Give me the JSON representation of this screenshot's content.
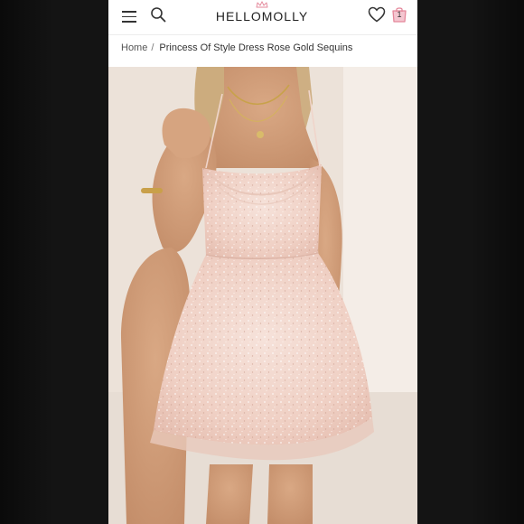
{
  "header": {
    "logo_text": "HELLOMOLLY",
    "menu_icon": "hamburger-menu-icon",
    "search_icon": "search-icon",
    "wishlist_icon": "heart-icon",
    "bag_icon": "shopping-bag-icon",
    "bag_count": "1",
    "accent_color": "#e4879a"
  },
  "breadcrumb": {
    "home": "Home",
    "separator": "/",
    "current": "Princess Of Style Dress Rose Gold Sequins"
  },
  "product_image": {
    "subject": "rose gold sequin mini dress on model",
    "dress_color": "#f1d6cc"
  }
}
